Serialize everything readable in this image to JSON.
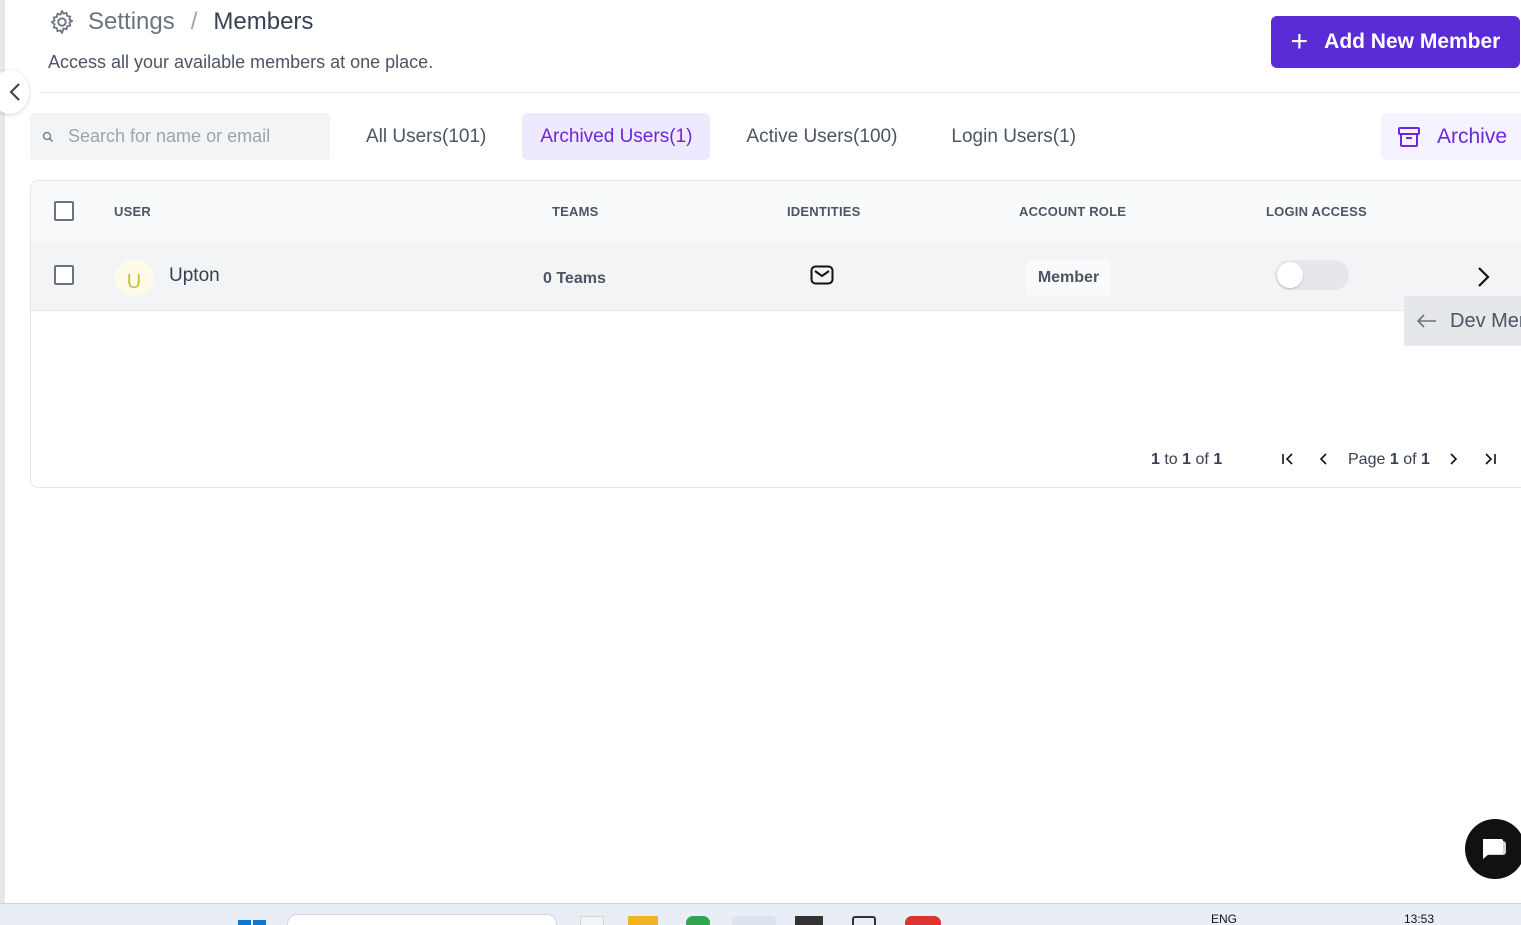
{
  "header": {
    "breadcrumb_root": "Settings",
    "breadcrumb_separator": "/",
    "breadcrumb_current": "Members",
    "subtitle": "Access all your available members at one place."
  },
  "actions": {
    "add_member_label": "Add New Member",
    "archive_label": "Archive"
  },
  "search": {
    "placeholder": "Search for name or email",
    "value": ""
  },
  "tabs": [
    {
      "label": "All Users(101)",
      "active": false
    },
    {
      "label": "Archived Users(1)",
      "active": true
    },
    {
      "label": "Active Users(100)",
      "active": false
    },
    {
      "label": "Login Users(1)",
      "active": false
    }
  ],
  "table": {
    "columns": [
      "USER",
      "TEAMS",
      "IDENTITIES",
      "ACCOUNT ROLE",
      "LOGIN ACCESS"
    ],
    "rows": [
      {
        "avatar_initial": "U",
        "name": "Upton",
        "teams": "0 Teams",
        "identity_icon": "mail-icon",
        "role": "Member",
        "login_access": false
      }
    ]
  },
  "pagination": {
    "range_from": "1",
    "range_to_word": "to",
    "range_to": "1",
    "range_of_word": "of",
    "range_total": "1",
    "page_word": "Page",
    "page_current": "1",
    "page_of_word": "of",
    "page_total": "1"
  },
  "dev_menu": {
    "label": "Dev Men"
  },
  "taskbar": {
    "language": "ENG",
    "time": "13:53"
  },
  "colors": {
    "primary": "#5a2cd6",
    "tab_active_bg": "#ede9fe",
    "tab_active_text": "#6d28d9"
  }
}
